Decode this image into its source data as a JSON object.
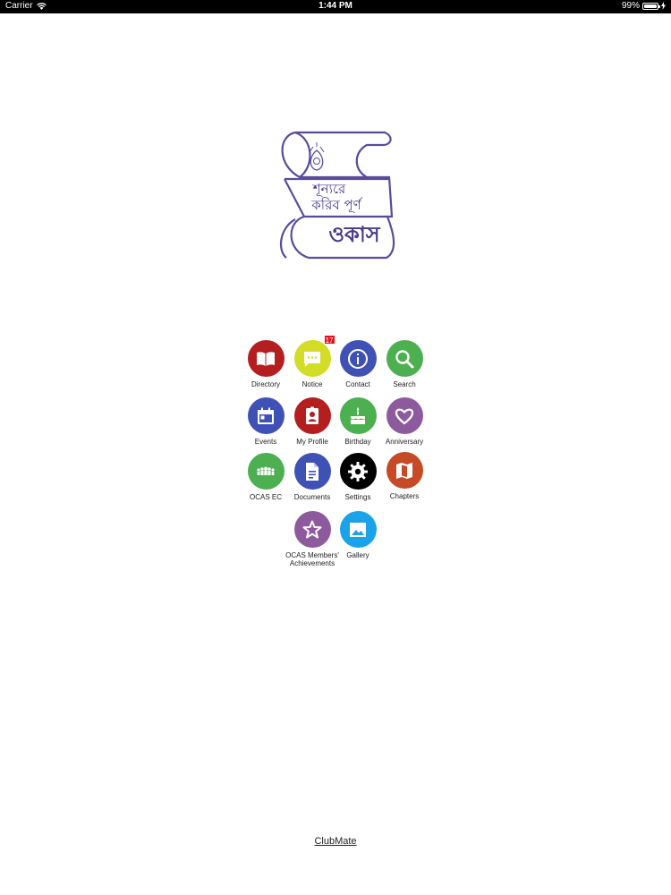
{
  "status_bar": {
    "carrier": "Carrier",
    "time": "1:44 PM",
    "battery": "99%",
    "battery_level": 0.99
  },
  "logo": {
    "line1": "শূন্যরে",
    "line2": "করিব পূর্ণ",
    "line3": "ওকাস",
    "color": "#4a3a8c"
  },
  "menu": {
    "directory": {
      "label": "Directory",
      "color": "#b41e1e",
      "icon": "book-icon"
    },
    "notice": {
      "label": "Notice",
      "color": "#d3dc26",
      "icon": "chat-bubble-icon",
      "badge": "17"
    },
    "contact": {
      "label": "Contact",
      "color": "#3f51b5",
      "icon": "info-icon"
    },
    "search": {
      "label": "Search",
      "color": "#4caf50",
      "icon": "search-icon"
    },
    "events": {
      "label": "Events",
      "color": "#3f51b5",
      "icon": "calendar-icon"
    },
    "my_profile": {
      "label": "My Profile",
      "color": "#b41e1e",
      "icon": "id-badge-icon"
    },
    "birthday": {
      "label": "Birthday",
      "color": "#4caf50",
      "icon": "cake-icon"
    },
    "anniversary": {
      "label": "Anniversary",
      "color": "#8e5a9e",
      "icon": "heart-icon"
    },
    "ocas_ec": {
      "label": "OCAS EC",
      "color": "#4caf50",
      "icon": "group-icon"
    },
    "documents": {
      "label": "Documents",
      "color": "#3f51b5",
      "icon": "document-icon"
    },
    "settings": {
      "label": "Settings",
      "color": "#000000",
      "icon": "gear-icon"
    },
    "chapters": {
      "label": "Chapters",
      "color": "#c64a26",
      "icon": "map-icon"
    },
    "achievements": {
      "label_line1": "OCAS Members'",
      "label_line2": "Achievements",
      "color": "#8e5a9e",
      "icon": "star-icon"
    },
    "gallery": {
      "label": "Gallery",
      "color": "#1aa3e8",
      "icon": "image-icon"
    }
  },
  "footer": {
    "link": "ClubMate"
  }
}
